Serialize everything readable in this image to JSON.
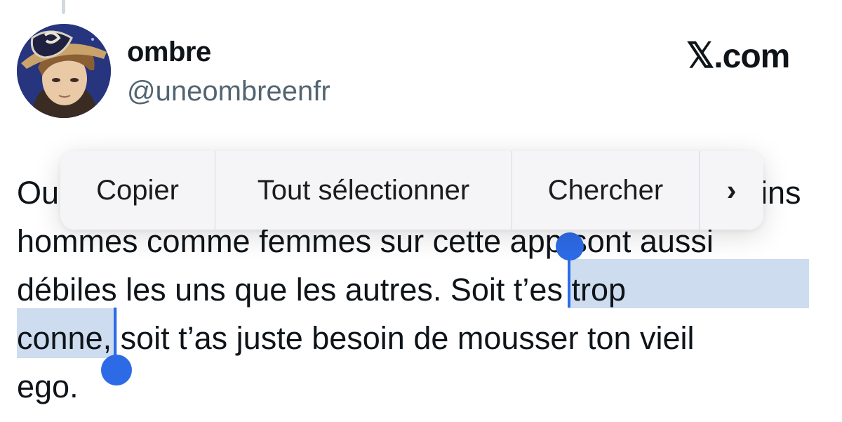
{
  "author": {
    "display_name": "ombre",
    "handle": "@uneombreenfr"
  },
  "site": {
    "x_glyph": "𝕏",
    "domain": ".com"
  },
  "tweet": {
    "line1_start": "Ou",
    "line1_end": "ins",
    "line2": "hommes comme femmes sur cette app sont aussi",
    "line3_a": "débiles les uns que les autres. Soit ",
    "line3_sel": "t’es trop",
    "line4_sel": "conne",
    "line4_rest": ", soit t’as juste besoin de mousser ton vieil",
    "line5": "ego."
  },
  "context_menu": {
    "copy": "Copier",
    "select_all": "Tout sélectionner",
    "search": "Chercher",
    "more": "›"
  },
  "colors": {
    "selection": "#cddcee",
    "handle": "#2d6be6",
    "handle_text": "#536471"
  }
}
